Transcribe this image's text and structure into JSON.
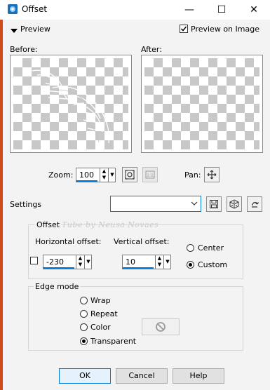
{
  "window": {
    "title": "Offset",
    "minimize_glyph": "—",
    "maximize_glyph": "☐",
    "close_glyph": "✕"
  },
  "preview": {
    "toggle_label": "Preview",
    "preview_on_image_label": "Preview on Image",
    "preview_on_image_checked": true,
    "before_label": "Before:",
    "after_label": "After:",
    "zoom_label": "Zoom:",
    "zoom_value": "100",
    "pan_label": "Pan:"
  },
  "settings": {
    "label": "Settings",
    "preset_value": ""
  },
  "offset": {
    "group_label": "Offset",
    "watermark": "Tube by Neusa Novaes",
    "horizontal_label": "Horizontal offset:",
    "horizontal_value": "-230",
    "vertical_label": "Vertical offset:",
    "vertical_value": "10",
    "center_label": "Center",
    "custom_label": "Custom",
    "selected": "Custom"
  },
  "edge_mode": {
    "group_label": "Edge mode",
    "options": [
      "Wrap",
      "Repeat",
      "Color",
      "Transparent"
    ],
    "selected": "Transparent"
  },
  "buttons": {
    "ok": "OK",
    "cancel": "Cancel",
    "help": "Help"
  },
  "icons": {
    "app": "app-icon",
    "zoom_fit": "zoom-fit-icon",
    "zoom_actual": "zoom-actual-icon",
    "pan": "pan-move-icon",
    "save_preset": "save-preset-icon",
    "random": "dice-icon",
    "reset": "reset-icon",
    "no_color": "no-color-icon"
  },
  "colors": {
    "accent": "#0078d7",
    "checker": "#c8c8c8",
    "window_edge": "#d14a1c"
  }
}
